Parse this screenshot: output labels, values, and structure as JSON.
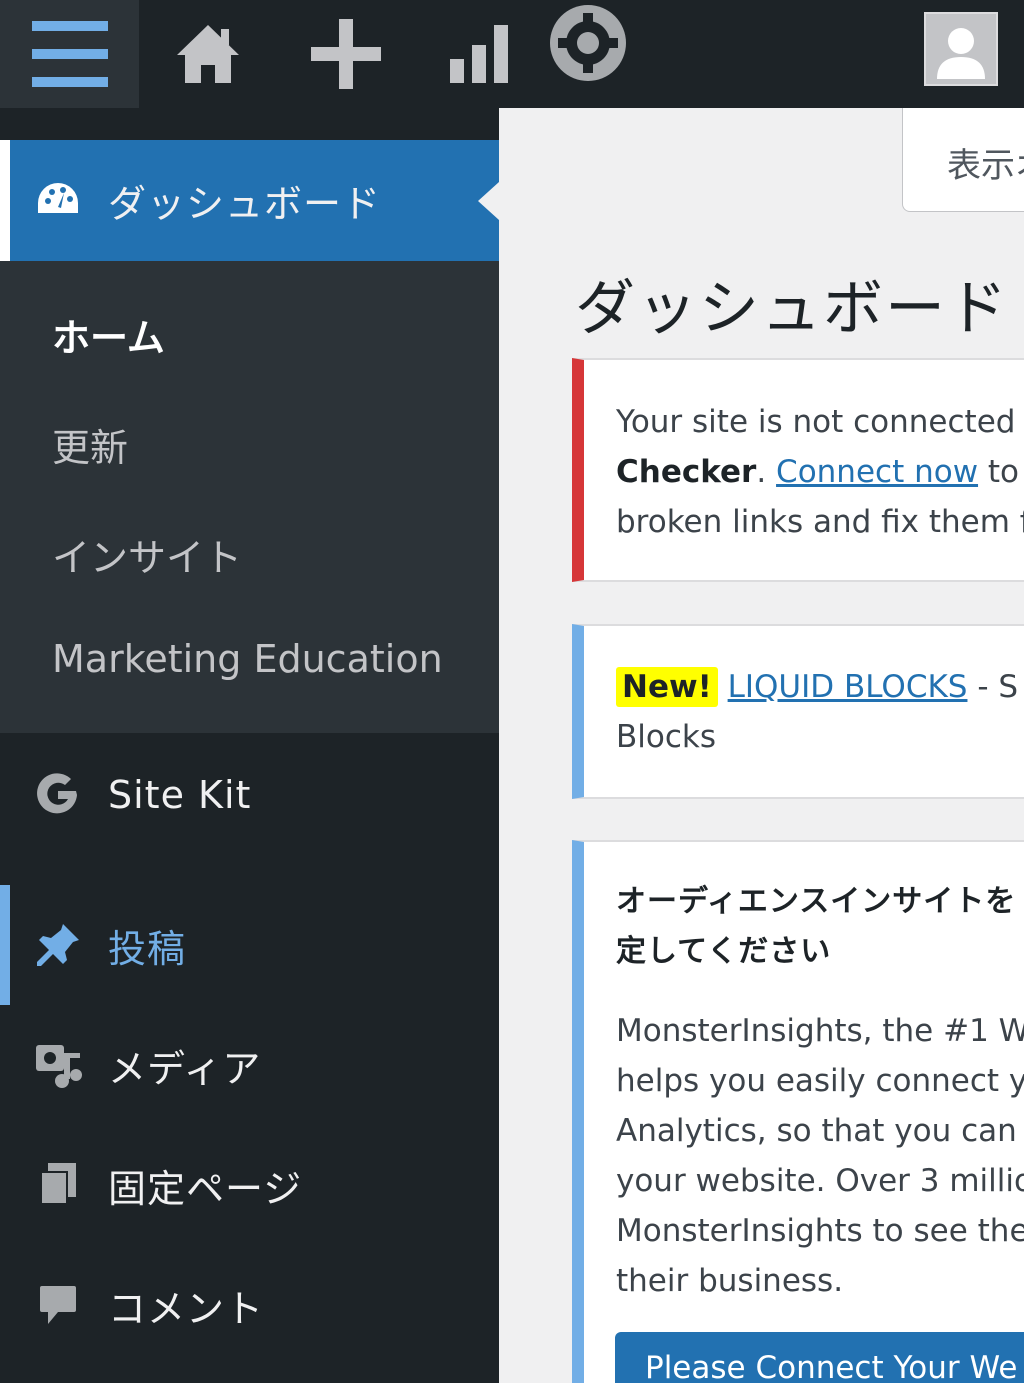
{
  "admin_bar": {
    "icons": [
      "menu-icon",
      "home-icon",
      "plus-icon",
      "stats-icon",
      "gear-icon",
      "avatar"
    ]
  },
  "sidebar": {
    "dashboard_label": "ダッシュボード",
    "submenu": [
      "ホーム",
      "更新",
      "インサイト",
      "Marketing Education"
    ],
    "items": [
      {
        "label": "Site Kit",
        "icon": "google-g-icon"
      },
      {
        "label": "投稿",
        "icon": "pin-icon"
      },
      {
        "label": "メディア",
        "icon": "media-icon"
      },
      {
        "label": "固定ページ",
        "icon": "pages-icon"
      },
      {
        "label": "コメント",
        "icon": "comment-icon"
      }
    ]
  },
  "content": {
    "screen_options": "表示オ",
    "page_title": "ダッシュボード",
    "notice_error": {
      "line1": "Your site is not connected",
      "line2_bold": "Checker",
      "line2_dot": ".",
      "line2_link": "Connect now",
      "line2_rest": " to",
      "line3": "broken links and fix them f"
    },
    "notice_info": {
      "badge": "New!",
      "link": "LIQUID BLOCKS",
      "rest": " - S",
      "line2": "Blocks"
    },
    "notice_mi": {
      "heading1": "オーディエンスインサイトを",
      "heading2": "定してください",
      "body": [
        "MonsterInsights, the #1 W",
        "helps you easily connect y",
        "Analytics, so that you can",
        "your website. Over 3 millio",
        "MonsterInsights to see the",
        "their business."
      ],
      "button": "Please Connect Your We"
    }
  },
  "colors": {
    "adminbar_bg": "#1d2327",
    "accent_blue": "#2271b1",
    "error_red": "#d63638",
    "info_blue": "#72aee6"
  }
}
